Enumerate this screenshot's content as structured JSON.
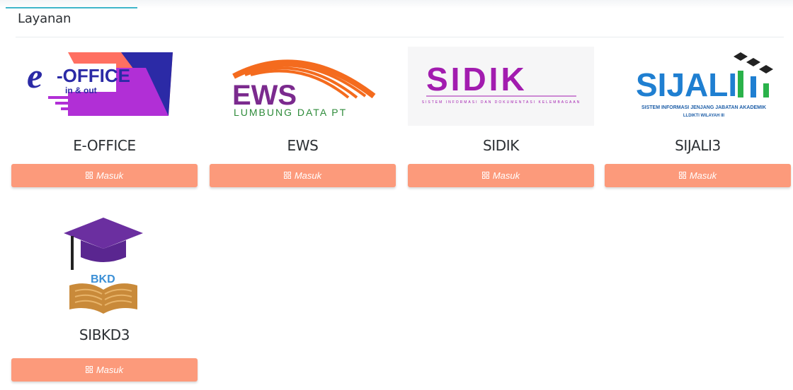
{
  "section": {
    "title": "Layanan"
  },
  "cards": [
    {
      "name": "E-OFFICE",
      "button": "Masuk",
      "logo_text": "-OFFICE",
      "logo_sub": "in & out"
    },
    {
      "name": "EWS",
      "button": "Masuk",
      "logo_text": "EWS",
      "logo_sub": "LUMBUNG DATA PT"
    },
    {
      "name": "SIDIK",
      "button": "Masuk",
      "logo_text": "SIDIK",
      "logo_sub": "SISTEM INFORMASI DAN DOKUMENTASI KELEMBAGAAN"
    },
    {
      "name": "SIJALI3",
      "button": "Masuk",
      "logo_text": "SIJALI",
      "logo_sub": "SISTEM INFORMASI JENJANG JABATAN AKADEMIK",
      "logo_sub2": "LLDIKTI WILAYAH III"
    },
    {
      "name": "SIBKD3",
      "button": "Masuk",
      "logo_text": "BKD"
    }
  ],
  "colors": {
    "accent": "#3fb6c9",
    "button": "#fc9a7b"
  }
}
